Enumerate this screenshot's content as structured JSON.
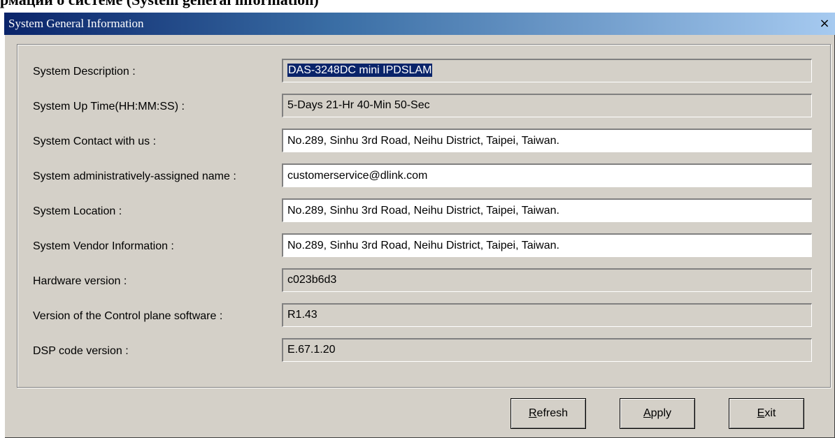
{
  "page_heading": "рмации о системе (System general information)",
  "window": {
    "title": "System General Information",
    "close_glyph": "×"
  },
  "fields": [
    {
      "label": "System Description :",
      "value": "DAS-3248DC mini IPDSLAM",
      "editable": false,
      "selected": true
    },
    {
      "label": "System Up Time(HH:MM:SS) :",
      "value": "5-Days 21-Hr 40-Min 50-Sec",
      "editable": false
    },
    {
      "label": "System Contact with us :",
      "value": "No.289, Sinhu 3rd Road, Neihu District, Taipei, Taiwan.",
      "editable": true
    },
    {
      "label": "System administratively-assigned name :",
      "value": "customerservice@dlink.com",
      "editable": true
    },
    {
      "label": "System Location :",
      "value": "No.289, Sinhu 3rd Road, Neihu District, Taipei, Taiwan.",
      "editable": true
    },
    {
      "label": "System Vendor Information :",
      "value": "No.289, Sinhu 3rd Road, Neihu District, Taipei, Taiwan.",
      "editable": true
    },
    {
      "label": "Hardware version :",
      "value": "c023b6d3",
      "editable": false
    },
    {
      "label": "Version of the Control plane software :",
      "value": "R1.43",
      "editable": false
    },
    {
      "label": "DSP code version :",
      "value": "E.67.1.20",
      "editable": false
    }
  ],
  "buttons": {
    "refresh": {
      "first": "R",
      "rest": "efresh"
    },
    "apply": {
      "first": "A",
      "rest": "pply"
    },
    "exit": {
      "first": "E",
      "rest": "xit"
    }
  },
  "colors": {
    "titlebar_start": "#0a246a",
    "titlebar_end": "#a6caf0",
    "dialog_face": "#d4d0c8",
    "selection": "#0a246a"
  }
}
